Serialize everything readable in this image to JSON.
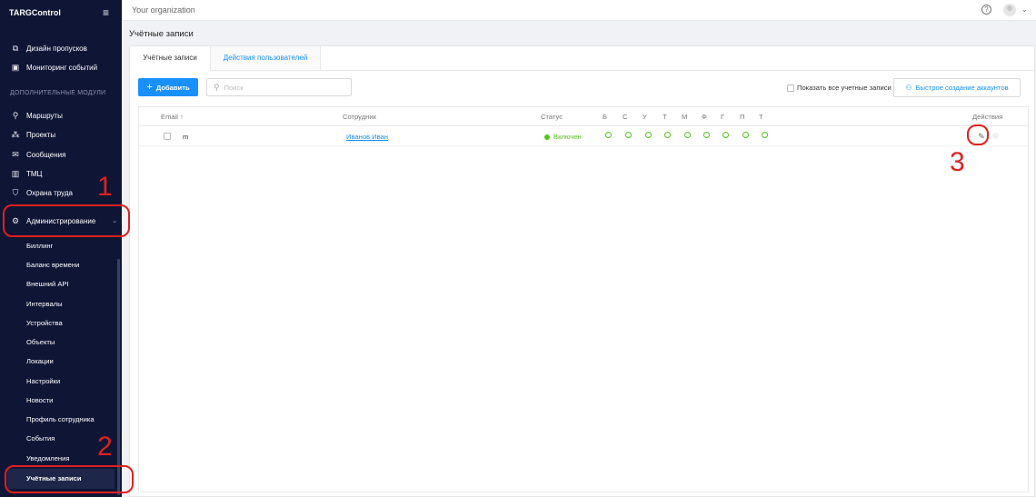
{
  "sidebar": {
    "brand": "TARGControl",
    "menu_icon": "hamburger-icon",
    "top_items": [
      {
        "label": "Дизайн пропусков",
        "icon": "design-icon"
      },
      {
        "label": "Мониторинг событий",
        "icon": "monitor-icon"
      }
    ],
    "section_label": "ДОПОЛНИТЕЛЬНЫЕ МОДУЛИ",
    "modules": [
      {
        "label": "Маршруты",
        "icon": "route-icon"
      },
      {
        "label": "Проекты",
        "icon": "projects-icon"
      },
      {
        "label": "Сообщения",
        "icon": "mail-icon"
      },
      {
        "label": "ТМЦ",
        "icon": "inventory-icon"
      },
      {
        "label": "Охрана труда",
        "icon": "shield-icon"
      }
    ],
    "admin": {
      "label": "Администрирование",
      "icon": "gear-icon"
    },
    "admin_items": [
      "Биллинг",
      "Баланс времени",
      "Внешний API",
      "Интервалы",
      "Устройства",
      "Объекты",
      "Локации",
      "Настройки",
      "Новости",
      "Профиль сотрудника",
      "События",
      "Уведомления",
      "Учётные записи"
    ]
  },
  "topbar": {
    "org": "Your organization",
    "help": "?"
  },
  "page": {
    "title": "Учётные записи",
    "tabs": [
      "Учётные записи",
      "Действия пользователей"
    ]
  },
  "toolbar": {
    "add_label": "Добавить",
    "search_placeholder": "Поиск",
    "show_all_label": "Показать все учетные записи",
    "quick_label": "Быстрое создание аккаунтов"
  },
  "table": {
    "headers": {
      "email": "Email",
      "email_sort": "↑",
      "employee": "Сотрудник",
      "status": "Статус",
      "days": [
        "Б",
        "С",
        "У",
        "Т",
        "М",
        "Ф",
        "Г",
        "П",
        "Т"
      ],
      "actions": "Действия"
    },
    "rows": [
      {
        "email": "m",
        "employee": "Иванов Иван",
        "status": "Включен"
      }
    ]
  },
  "annotations": [
    "1",
    "2",
    "3"
  ],
  "colors": {
    "sidebar_bg": "#0f1535",
    "accent": "#1890ff",
    "status_green": "#52c41a",
    "annotation_red": "#e0201e"
  }
}
